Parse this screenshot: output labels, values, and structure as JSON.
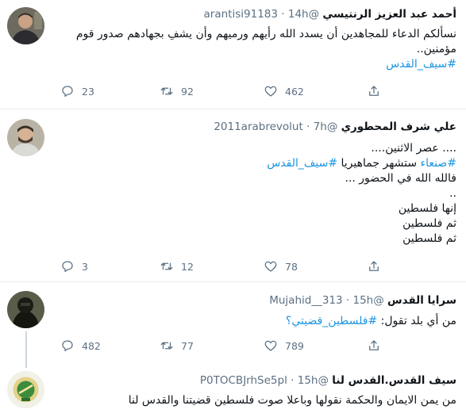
{
  "tweets": [
    {
      "name": "أحمد عبد العزيز الرنتيسي",
      "handle": "@arantisi91183",
      "time": "14h",
      "lines": [
        "نسألكم الدعاء للمجاهدين أن يسدد الله رأيهم ورميهم وأن يشفِ بجهادهم صدور قوم",
        "مؤمنين.."
      ],
      "hashtag": "#سيف_القدس",
      "replies": "23",
      "retweets": "92",
      "likes": "462"
    },
    {
      "name": "علي شرف المحطوري",
      "handle": "@2011arabrevolut",
      "time": "7h",
      "line1": ".... عصر الاثنين....",
      "line2_tag1": "#صنعاء",
      "line2_text": " ستشهر جماهيريا ",
      "line2_tag2": "#سيف_القدس",
      "line3": "فالله الله في الحضور ...",
      "line4": "..",
      "line5": "إنها فلسطين",
      "line6": "ثم فلسطين",
      "line7": "ثم فلسطين",
      "replies": "3",
      "retweets": "12",
      "likes": "78"
    },
    {
      "name": "سرايا القدس",
      "handle": "@Mujahid__313",
      "time": "15h",
      "text": "من أي بلد تقول: ",
      "hashtag": "#فلسطين_قضيتي؟",
      "replies": "482",
      "retweets": "77",
      "likes": "789"
    },
    {
      "name": "سيف القدس.القدس لنا",
      "handle": "@P0TOCBJrhSe5pl",
      "time": "15h",
      "text": "من يمن الايمان والحكمة نقولها وباعلا صوت فلسطين قضيتنا والقدس لنا"
    }
  ],
  "colors": {
    "hashtag": "#1b95e0",
    "meta": "#5b7083",
    "border": "#e6ecf0"
  },
  "icons": [
    "reply-icon",
    "retweet-icon",
    "like-icon",
    "share-icon"
  ]
}
